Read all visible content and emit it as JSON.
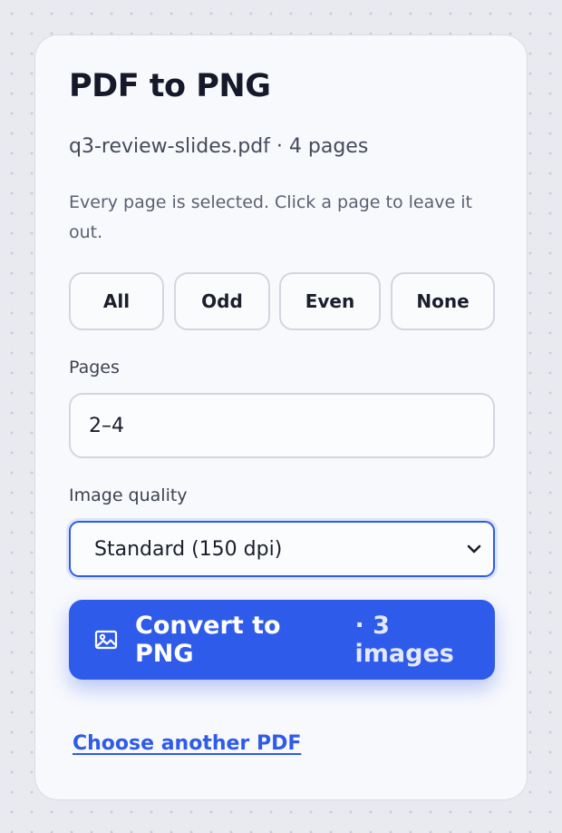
{
  "title": "PDF to PNG",
  "file": {
    "info": "q3-review-slides.pdf · 4 pages"
  },
  "hint": "Every page is selected. Click a page to leave it out.",
  "selection_buttons": [
    "All",
    "Odd",
    "Even",
    "None"
  ],
  "pages_field": {
    "label": "Pages",
    "value": "2–4"
  },
  "quality_field": {
    "label": "Image quality",
    "selected": "Standard (150 dpi)"
  },
  "convert_button": {
    "label": "Convert to PNG",
    "count": "· 3 images",
    "icon": "image-icon"
  },
  "secondary_link": "Choose another PDF",
  "colors": {
    "accent": "#2f5bea",
    "background": "#e8eaf0",
    "card": "#f8f9fc",
    "text": "#16192a"
  }
}
